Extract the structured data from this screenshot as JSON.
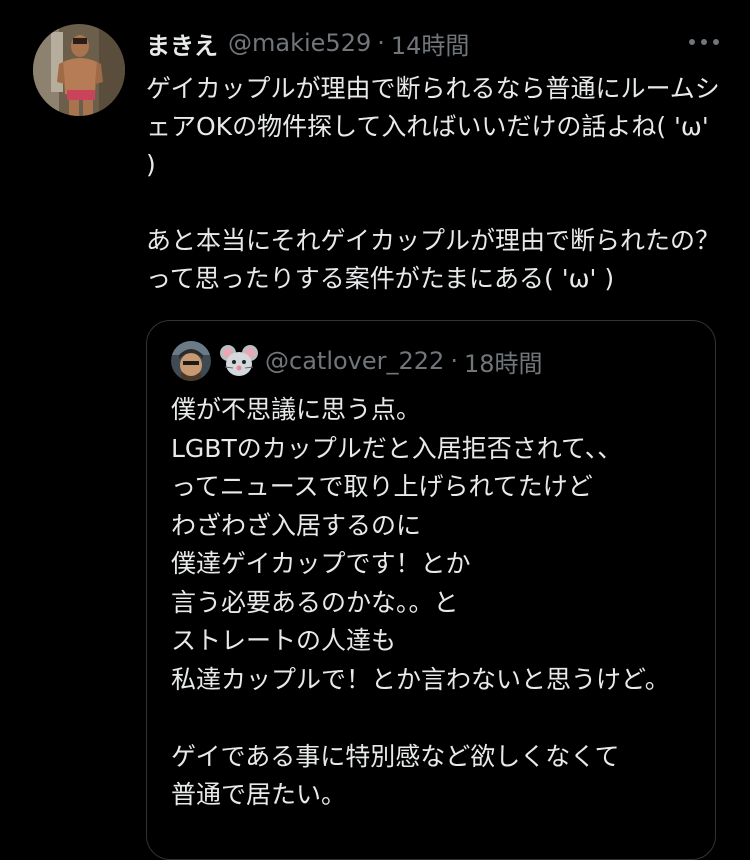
{
  "tweet": {
    "display_name": "まきえ",
    "handle": "@makie529",
    "separator": "·",
    "time": "14時間",
    "text": "ゲイカップルが理由で断られるなら普通にルームシェアOKの物件探して入ればいいだけの話よね( 'ω' )\n\nあと本当にそれゲイカップルが理由で断られたの？って思ったりする案件がたまにある( 'ω' )"
  },
  "quote": {
    "emoji": "🐭",
    "handle": "@catlover_222",
    "separator": "·",
    "time": "18時間",
    "text": "僕が不思議に思う点。\nLGBTのカップルだと入居拒否されて、、\nってニュースで取り上げられてたけど\nわざわざ入居するのに\n僕達ゲイカップです！とか\n言う必要あるのかな。。と\nストレートの人達も\n私達カップルで！とか言わないと思うけど。\n\nゲイである事に特別感など欲しくなくて\n普通で居たい。"
  },
  "icons": {
    "more": "more-horizontal-icon",
    "quote_avatar_emoji": "mouse-face-icon"
  },
  "colors": {
    "background": "#000000",
    "text": "#e7e9ea",
    "muted": "#71767b",
    "border": "#2f3336"
  }
}
